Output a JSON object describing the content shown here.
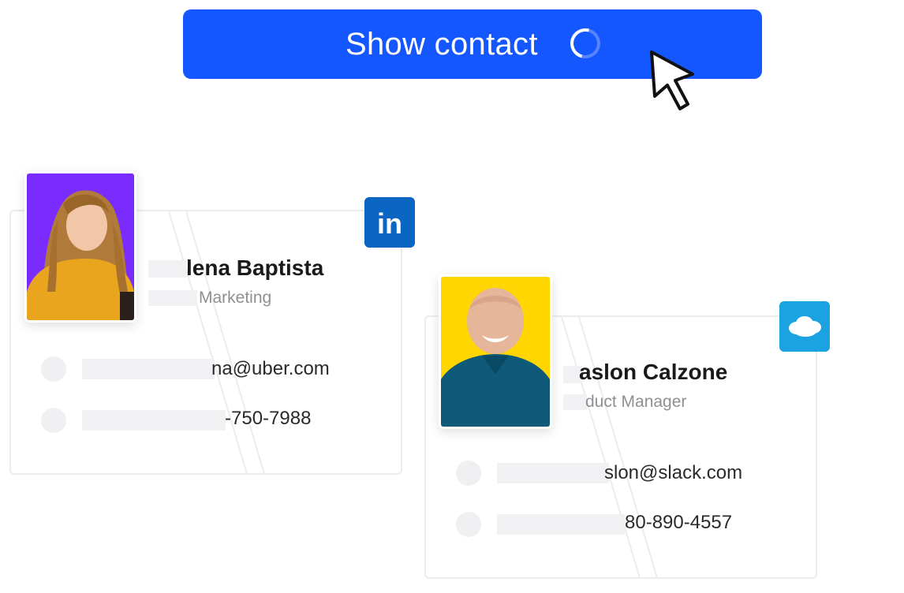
{
  "cta": {
    "label": "Show contact"
  },
  "colors": {
    "primary": "#1557ff",
    "linkedin": "#0a66c2",
    "salesforce": "#1ba2e0",
    "photo1_bg": "#7a2cff",
    "photo2_bg": "#ffd600"
  },
  "contacts": [
    {
      "name": "lena Baptista",
      "role": "Marketing",
      "email": "na@uber.com",
      "phone": "-750-7988",
      "source_icon": "linkedin-icon",
      "badge_text": "in"
    },
    {
      "name": "aslon Calzone",
      "role": "duct Manager",
      "email": "slon@slack.com",
      "phone": "80-890-4557",
      "source_icon": "salesforce-cloud-icon"
    }
  ]
}
